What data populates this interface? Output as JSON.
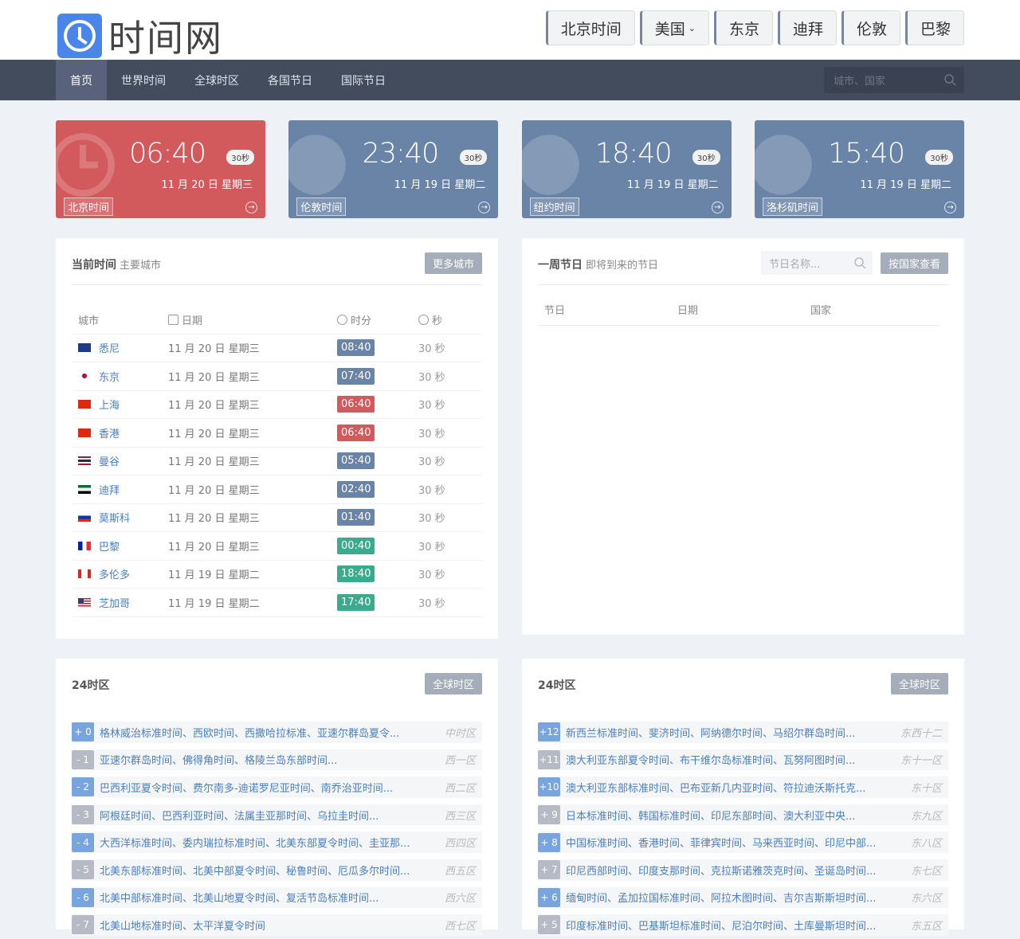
{
  "logo": {
    "text": "时间网"
  },
  "city_buttons": [
    {
      "label": "北京时间"
    },
    {
      "label": "美国",
      "caret": "⌄"
    },
    {
      "label": "东京"
    },
    {
      "label": "迪拜"
    },
    {
      "label": "伦敦"
    },
    {
      "label": "巴黎"
    }
  ],
  "nav": {
    "items": [
      "首页",
      "世界时间",
      "全球时区",
      "各国节日",
      "国际节日"
    ],
    "search_placeholder": "城市、国家"
  },
  "cards": [
    {
      "time": "06:40",
      "sec": "30秒",
      "date": "11 月 20 日 星期三",
      "label": "北京时间",
      "arrow": "→",
      "style": "red"
    },
    {
      "time": "23:40",
      "sec": "30秒",
      "date": "11 月 19 日 星期二",
      "label": "伦敦时间",
      "arrow": "→",
      "style": "blue"
    },
    {
      "time": "18:40",
      "sec": "30秒",
      "date": "11 月 19 日 星期二",
      "label": "纽约时间",
      "arrow": "→",
      "style": "blue"
    },
    {
      "time": "15:40",
      "sec": "30秒",
      "date": "11 月 19 日 星期二",
      "label": "洛杉矶时间",
      "arrow": "→",
      "style": "blue"
    }
  ],
  "current": {
    "title": "当前时间",
    "subtitle": "主要城市",
    "more_btn": "更多城市",
    "headers": {
      "city": "城市",
      "date": "日期",
      "hm": "时分",
      "sec": "秒"
    },
    "rows": [
      {
        "flag": "au",
        "city": "悉尼",
        "date": "11 月 20 日 星期三",
        "hm": "08:40",
        "hm_color": "#6a84a8",
        "sec": "30 秒"
      },
      {
        "flag": "jp",
        "city": "东京",
        "date": "11 月 20 日 星期三",
        "hm": "07:40",
        "hm_color": "#6a84a8",
        "sec": "30 秒"
      },
      {
        "flag": "cn",
        "city": "上海",
        "date": "11 月 20 日 星期三",
        "hm": "06:40",
        "hm_color": "#d25a5d",
        "sec": "30 秒"
      },
      {
        "flag": "cn",
        "city": "香港",
        "date": "11 月 20 日 星期三",
        "hm": "06:40",
        "hm_color": "#d25a5d",
        "sec": "30 秒"
      },
      {
        "flag": "th",
        "city": "曼谷",
        "date": "11 月 20 日 星期三",
        "hm": "05:40",
        "hm_color": "#6a84a8",
        "sec": "30 秒"
      },
      {
        "flag": "ae",
        "city": "迪拜",
        "date": "11 月 20 日 星期三",
        "hm": "02:40",
        "hm_color": "#6a84a8",
        "sec": "30 秒"
      },
      {
        "flag": "ru",
        "city": "莫斯科",
        "date": "11 月 20 日 星期三",
        "hm": "01:40",
        "hm_color": "#6a84a8",
        "sec": "30 秒"
      },
      {
        "flag": "fr",
        "city": "巴黎",
        "date": "11 月 20 日 星期三",
        "hm": "00:40",
        "hm_color": "#3bab8e",
        "sec": "30 秒"
      },
      {
        "flag": "ca",
        "city": "多伦多",
        "date": "11 月 19 日 星期二",
        "hm": "18:40",
        "hm_color": "#3bab8e",
        "sec": "30 秒"
      },
      {
        "flag": "us",
        "city": "芝加哥",
        "date": "11 月 19 日 星期二",
        "hm": "17:40",
        "hm_color": "#3bab8e",
        "sec": "30 秒"
      }
    ]
  },
  "holidays": {
    "title": "一周节日",
    "subtitle": "即将到来的节日",
    "search_placeholder": "节日名称...",
    "by_country_btn": "按国家查看",
    "headers": {
      "name": "节日",
      "date": "日期",
      "country": "国家"
    }
  },
  "tz_left": {
    "title": "24时区",
    "btn": "全球时区",
    "rows": [
      {
        "off": "+ 0",
        "names": "格林威治标准时间、西欧时间、西撒哈拉标准、亚速尔群岛夏令...",
        "zone": "中时区",
        "color": "blue"
      },
      {
        "off": "- 1",
        "names": "亚速尔群岛时间、佛得角时间、格陵兰岛东部时间...",
        "zone": "西一区",
        "color": "gray"
      },
      {
        "off": "- 2",
        "names": "巴西利亚夏令时间、费尔南多-迪诺罗尼亚时间、南乔治亚时间...",
        "zone": "西二区",
        "color": "blue"
      },
      {
        "off": "- 3",
        "names": "阿根廷时间、巴西利亚时间、法属圭亚那时间、乌拉圭时间...",
        "zone": "西三区",
        "color": "gray"
      },
      {
        "off": "- 4",
        "names": "大西洋标准时间、委内瑞拉标准时间、北美东部夏令时间、圭亚那...",
        "zone": "西四区",
        "color": "blue"
      },
      {
        "off": "- 5",
        "names": "北美东部标准时间、北美中部夏令时间、秘鲁时间、厄瓜多尔时间...",
        "zone": "西五区",
        "color": "gray"
      },
      {
        "off": "- 6",
        "names": "北美中部标准时间、北美山地夏令时间、复活节岛标准时间...",
        "zone": "西六区",
        "color": "blue"
      },
      {
        "off": "- 7",
        "names": "北美山地标准时间、太平洋夏令时间",
        "zone": "西七区",
        "color": "gray"
      }
    ]
  },
  "tz_right": {
    "title": "24时区",
    "btn": "全球时区",
    "rows": [
      {
        "off": "+12",
        "names": "新西兰标准时间、斐济时间、阿纳德尔时间、马绍尔群岛时间...",
        "zone": "东西十二",
        "color": "blue"
      },
      {
        "off": "+11",
        "names": "澳大利亚东部夏令时间、布干维尔岛标准时间、瓦努阿图时间...",
        "zone": "东十一区",
        "color": "gray"
      },
      {
        "off": "+10",
        "names": "澳大利亚东部标准时间、巴布亚新几内亚时间、符拉迪沃斯托克...",
        "zone": "东十区",
        "color": "blue"
      },
      {
        "off": "+ 9",
        "names": "日本标准时间、韩国标准时间、印尼东部时间、澳大利亚中央...",
        "zone": "东九区",
        "color": "gray"
      },
      {
        "off": "+ 8",
        "names": "中国标准时间、香港时间、菲律宾时间、马来西亚时间、印尼中部...",
        "zone": "东八区",
        "color": "blue"
      },
      {
        "off": "+ 7",
        "names": "印尼西部时间、印度支那时间、克拉斯诺雅茨克时间、圣诞岛时间...",
        "zone": "东七区",
        "color": "gray"
      },
      {
        "off": "+ 6",
        "names": "缅甸时间、孟加拉国标准时间、阿拉木图时间、吉尔吉斯斯坦时间...",
        "zone": "东六区",
        "color": "blue"
      },
      {
        "off": "+ 5",
        "names": "印度标准时间、巴基斯坦标准时间、尼泊尔时间、土库曼斯坦时间...",
        "zone": "东五区",
        "color": "gray"
      }
    ]
  }
}
